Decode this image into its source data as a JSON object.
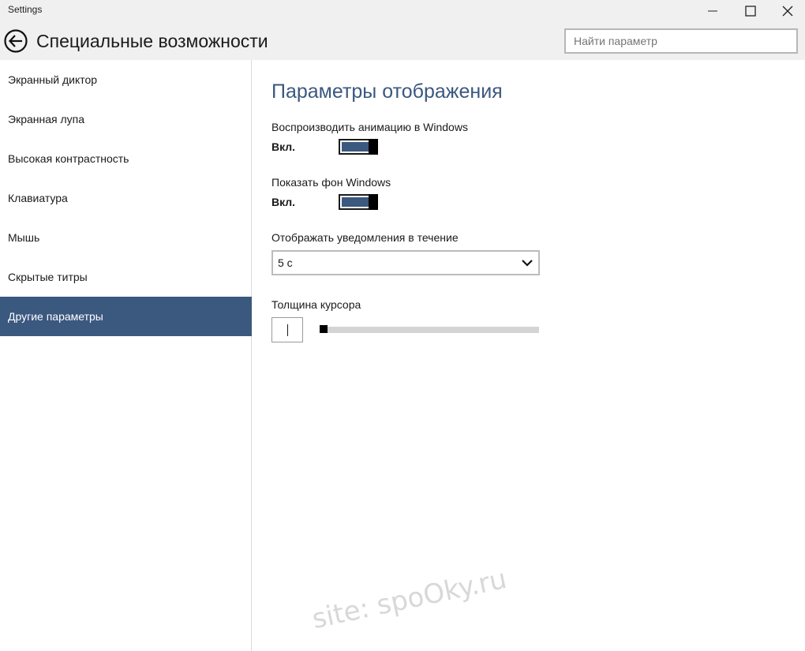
{
  "window": {
    "app_title": "Settings",
    "controls": {
      "minimize_icon": "minimize-icon",
      "maximize_icon": "maximize-icon",
      "close_icon": "close-icon"
    }
  },
  "header": {
    "back_icon": "back-arrow-icon",
    "title": "Специальные возможности",
    "search_placeholder": "Найти параметр"
  },
  "sidebar": {
    "items": [
      {
        "label": "Экранный диктор",
        "active": false
      },
      {
        "label": "Экранная лупа",
        "active": false
      },
      {
        "label": "Высокая контрастность",
        "active": false
      },
      {
        "label": "Клавиатура",
        "active": false
      },
      {
        "label": "Мышь",
        "active": false
      },
      {
        "label": "Скрытые титры",
        "active": false
      },
      {
        "label": "Другие параметры",
        "active": true
      }
    ]
  },
  "main": {
    "section_title": "Параметры отображения",
    "animation": {
      "label": "Воспроизводить анимацию в Windows",
      "state": "Вкл.",
      "on": true
    },
    "background": {
      "label": "Показать фон Windows",
      "state": "Вкл.",
      "on": true
    },
    "notifications": {
      "label": "Отображать уведомления в течение",
      "value": "5 с"
    },
    "cursor": {
      "label": "Толщина курсора",
      "level": 1
    }
  },
  "watermark": "site: spoOky.ru",
  "colors": {
    "accent": "#3b587f",
    "chrome": "#f0f0f0"
  }
}
